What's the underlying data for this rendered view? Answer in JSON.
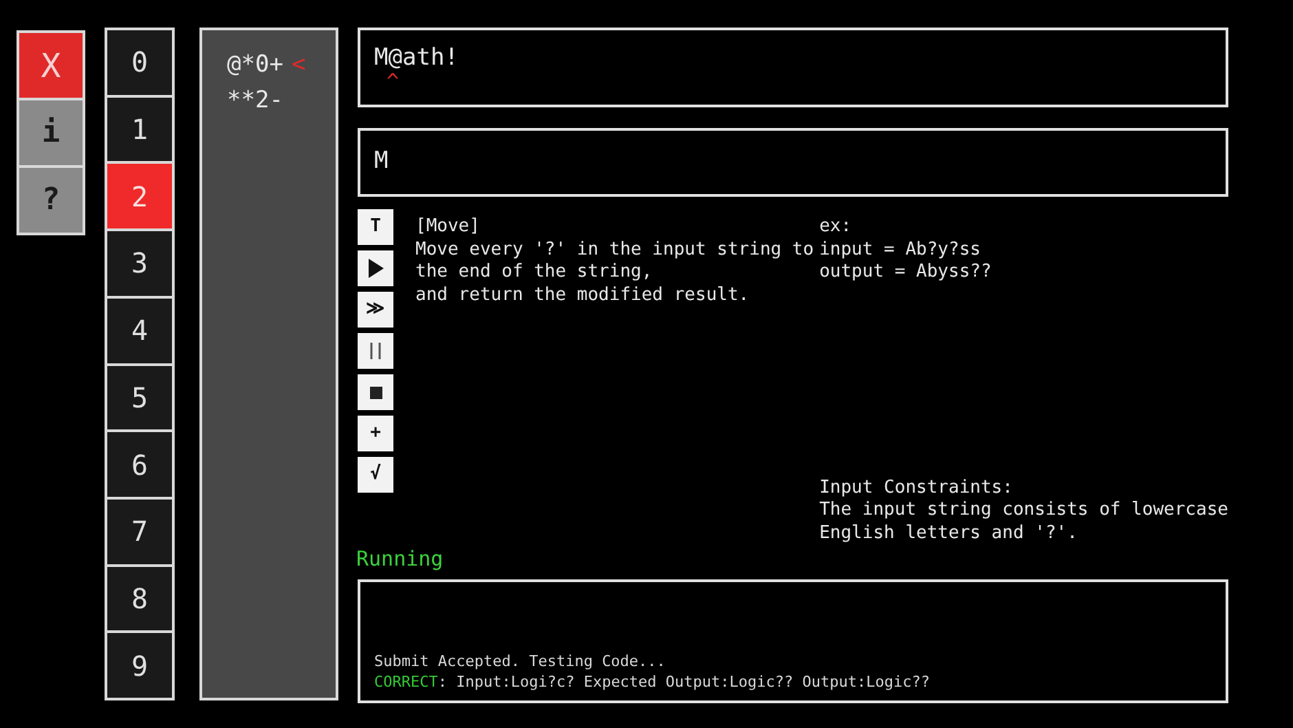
{
  "side_buttons": [
    {
      "kind": "close",
      "label": "X"
    },
    {
      "kind": "info",
      "label": "i"
    },
    {
      "kind": "help",
      "label": "?"
    }
  ],
  "slots": [
    {
      "label": "0",
      "selected": false
    },
    {
      "label": "1",
      "selected": false
    },
    {
      "label": "2",
      "selected": true
    },
    {
      "label": "3",
      "selected": false
    },
    {
      "label": "4",
      "selected": false
    },
    {
      "label": "5",
      "selected": false
    },
    {
      "label": "6",
      "selected": false
    },
    {
      "label": "7",
      "selected": false
    },
    {
      "label": "8",
      "selected": false
    },
    {
      "label": "9",
      "selected": false
    }
  ],
  "program": {
    "lines": [
      {
        "text": "@*0+",
        "marker": "<"
      },
      {
        "text": "**2-"
      }
    ]
  },
  "input_field": {
    "value": "M@ath!",
    "caret_line": " ^"
  },
  "output_field": {
    "value": "M"
  },
  "toolbar": [
    {
      "kind": "text",
      "label": "T"
    },
    {
      "kind": "play"
    },
    {
      "kind": "text",
      "label": "≫"
    },
    {
      "kind": "pause"
    },
    {
      "kind": "stop"
    },
    {
      "kind": "text",
      "label": "+"
    },
    {
      "kind": "text",
      "label": "√"
    }
  ],
  "task": {
    "title": "[Move]",
    "lines": [
      "Move every '?' in the input string to",
      "the end of the string,",
      "and return the modified result."
    ]
  },
  "example": {
    "lines": [
      "ex:",
      "input = Ab?y?ss",
      "output = Abyss??"
    ]
  },
  "constraints": {
    "lines": [
      "Input Constraints:",
      "The input string consists of lowercase",
      "English letters and '?'."
    ]
  },
  "status": "Running",
  "console": [
    {
      "kind": "plain",
      "text": "Submit Accepted. Testing Code..."
    },
    {
      "kind": "result",
      "status": "CORRECT",
      "text": ": Input:Logi?c? Expected Output:Logic?? Output:Logic??"
    }
  ]
}
